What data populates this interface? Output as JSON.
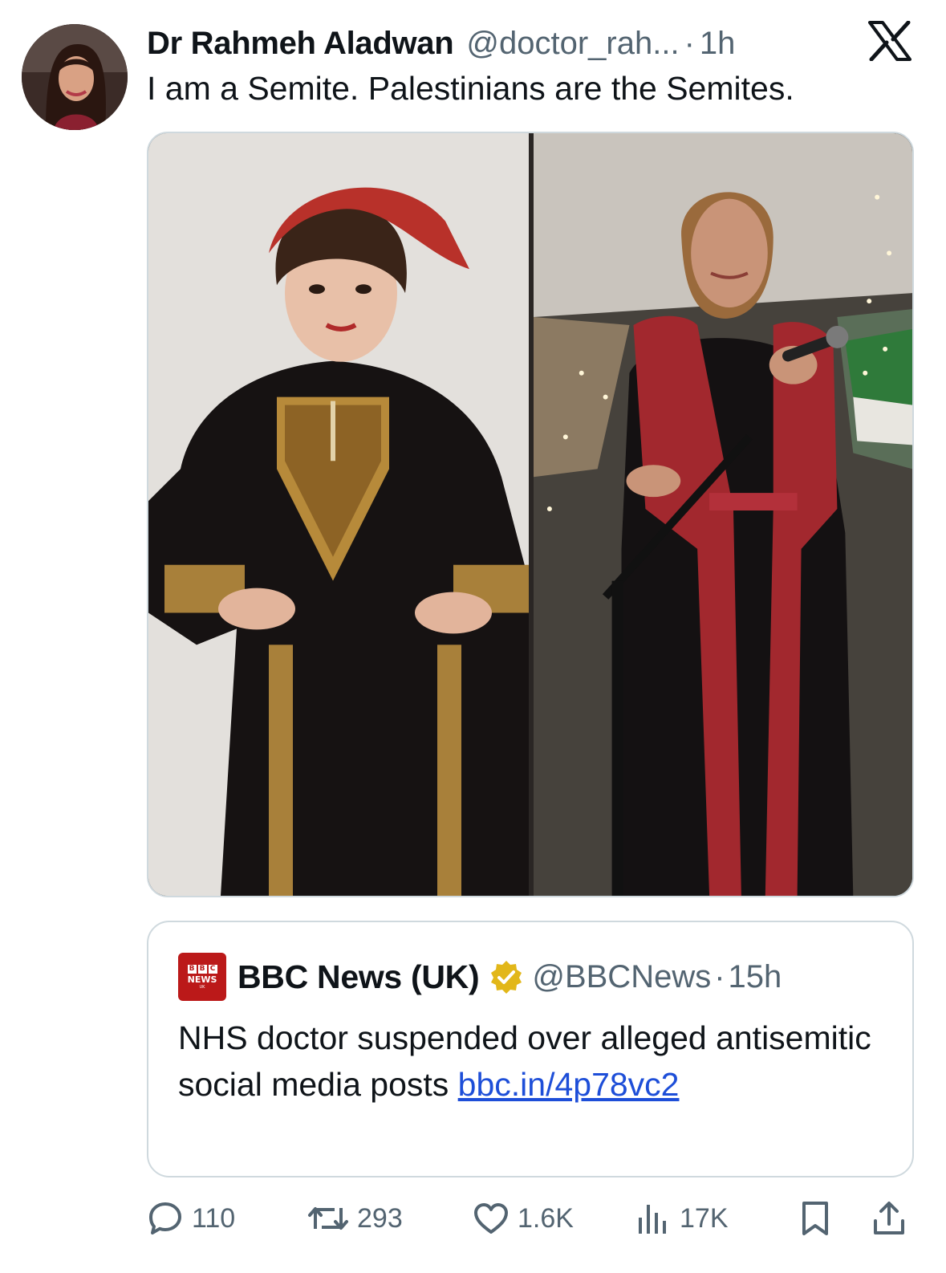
{
  "tweet": {
    "display_name": "Dr Rahmeh Aladwan",
    "handle": "@doctor_rah...",
    "separator": "·",
    "time": "1h",
    "text": "I am a Semite. Palestinians are the Semites."
  },
  "quoted_tweet": {
    "logo_letters": [
      "B",
      "B",
      "C"
    ],
    "logo_word": "NEWS",
    "logo_sub": "UK",
    "display_name": "BBC News (UK)",
    "handle": "@BBCNews",
    "separator": "·",
    "time": "15h",
    "text": "NHS doctor suspended over alleged antisemitic social media posts ",
    "link": "bbc.in/4p78vc2"
  },
  "actions": {
    "replies": "110",
    "reposts": "293",
    "likes": "1.6K",
    "views": "17K"
  },
  "icons": {
    "platform": "x-logo-icon",
    "verified": "verified-badge-icon",
    "reply": "reply-icon",
    "repost": "repost-icon",
    "like": "heart-icon",
    "views": "views-icon",
    "bookmark": "bookmark-icon",
    "share": "share-icon"
  },
  "colors": {
    "text": "#0f1419",
    "secondary": "#536471",
    "border": "#cfd9de",
    "link": "#1d4ed8",
    "bbc_red": "#bb1919",
    "verified_gold": "#e2b719"
  }
}
